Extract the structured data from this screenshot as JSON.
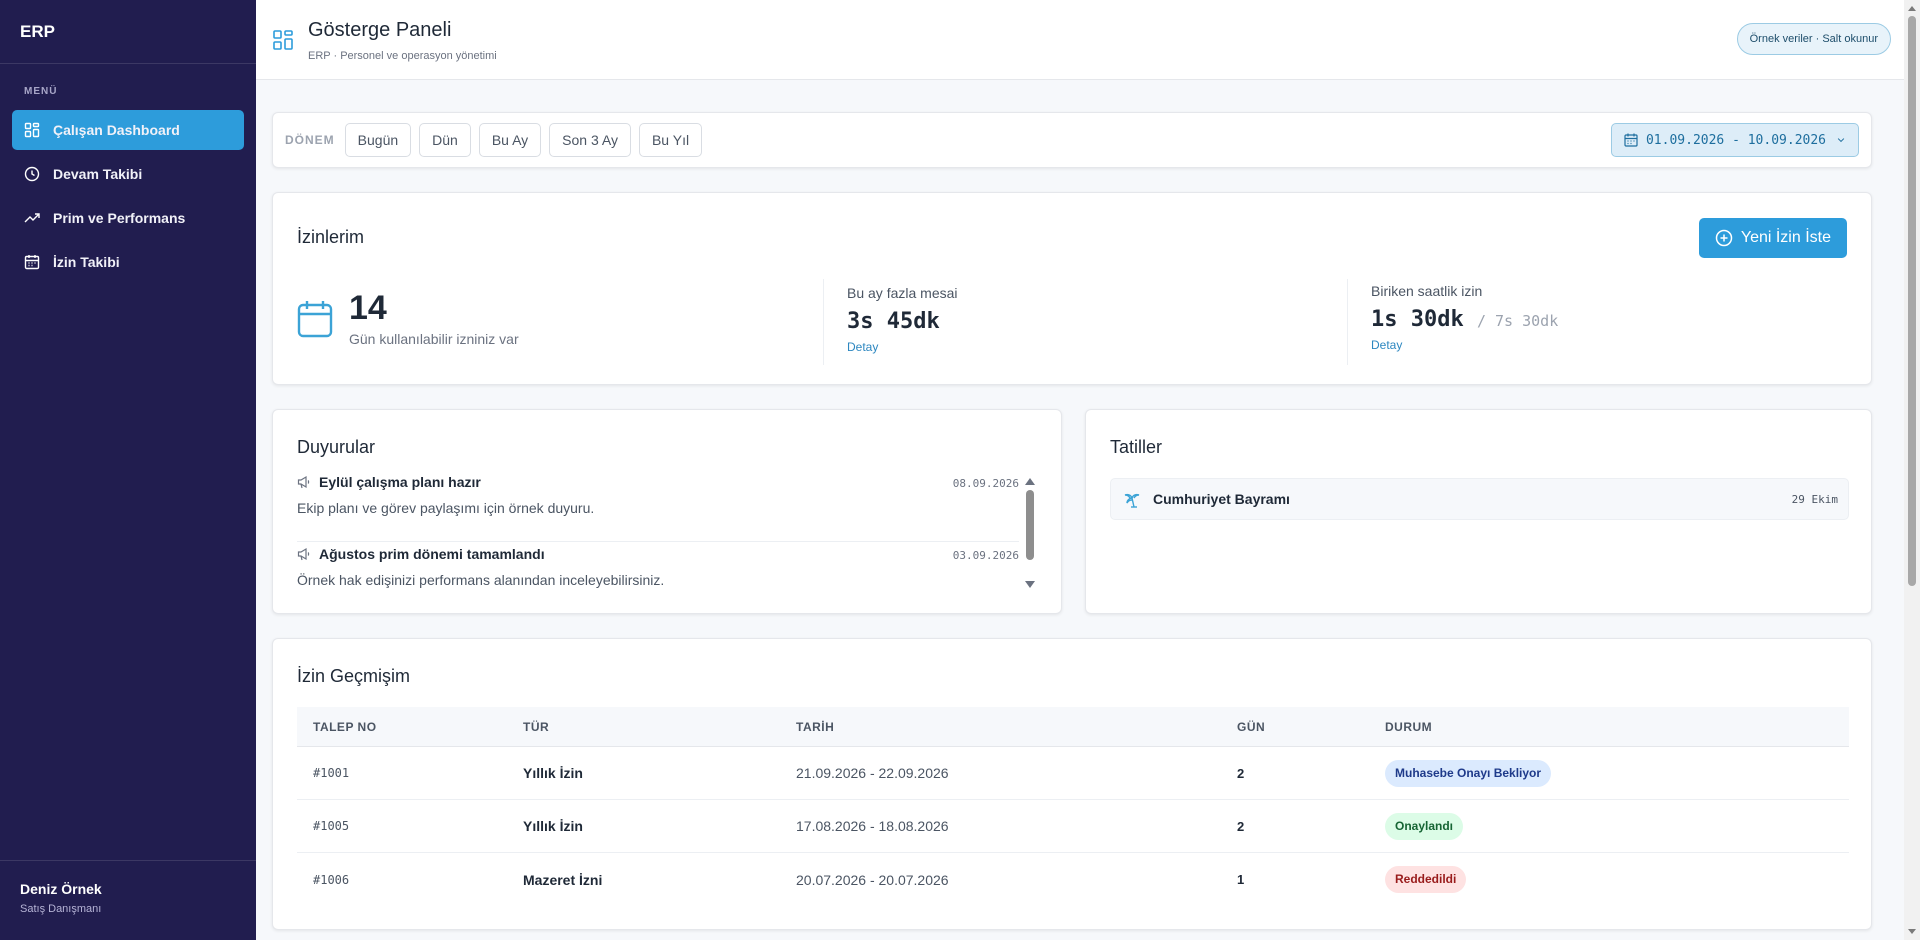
{
  "app": {
    "brand": "ERP"
  },
  "sidebar": {
    "menu_title": "MENÜ",
    "items": [
      {
        "label": "Çalışan Dashboard",
        "icon": "dashboard-icon",
        "active": true
      },
      {
        "label": "Devam Takibi",
        "icon": "clock-icon"
      },
      {
        "label": "Prim ve Performans",
        "icon": "trending-up-icon"
      },
      {
        "label": "İzin Takibi",
        "icon": "calendar-icon"
      }
    ],
    "profile": {
      "name": "Deniz Örnek",
      "role": "Satış Danışmanı"
    }
  },
  "header": {
    "title": "Gösterge Paneli",
    "subtitle": "ERP · Personel ve operasyon yönetimi",
    "badge": "Örnek veriler · Salt okunur"
  },
  "period": {
    "label": "DÖNEM",
    "buttons": [
      "Bugün",
      "Dün",
      "Bu Ay",
      "Son 3 Ay",
      "Bu Yıl"
    ],
    "date_range": "01.09.2026 - 10.09.2026"
  },
  "leaves": {
    "title": "İzinlerim",
    "new_request": "Yeni İzin İste",
    "available_days": "14",
    "available_label": "Gün kullanılabilir izniniz var",
    "overtime": {
      "label": "Bu ay fazla mesai",
      "value": "3s 45dk",
      "link": "Detay"
    },
    "hourly": {
      "label": "Biriken saatlik izin",
      "value": "1s 30dk",
      "limit": "/ 7s 30dk",
      "link": "Detay"
    }
  },
  "announcements": {
    "title": "Duyurular",
    "items": [
      {
        "title": "Eylül çalışma planı hazır",
        "date": "08.09.2026",
        "body": "Ekip planı ve görev paylaşımı için örnek duyuru."
      },
      {
        "title": "Ağustos prim dönemi tamamlandı",
        "date": "03.09.2026",
        "body": "Örnek hak edişinizi performans alanından inceleyebilirsiniz."
      }
    ]
  },
  "holidays": {
    "title": "Tatiller",
    "items": [
      {
        "name": "Cumhuriyet Bayramı",
        "date": "29 Ekim"
      }
    ]
  },
  "history": {
    "title": "İzin Geçmişim",
    "columns": [
      "TALEP NO",
      "TÜR",
      "TARİH",
      "GÜN",
      "DURUM"
    ],
    "rows": [
      {
        "no": "#1001",
        "type": "Yıllık İzin",
        "date": "21.09.2026 - 22.09.2026",
        "days": "2",
        "status": "Muhasebe Onayı Bekliyor",
        "status_color": "#dbeafe"
      },
      {
        "no": "#1005",
        "type": "Yıllık İzin",
        "date": "17.08.2026 - 18.08.2026",
        "days": "2",
        "status": "Onaylandı",
        "status_color": "#dcfce7"
      },
      {
        "no": "#1006",
        "type": "Mazeret İzni",
        "date": "20.07.2026 - 20.07.2026",
        "days": "1",
        "status": "Reddedildi",
        "status_color": "#fee2e2"
      }
    ]
  },
  "colors": {
    "sidebar_bg": "#211d4f",
    "accent": "#2d9cdb"
  }
}
